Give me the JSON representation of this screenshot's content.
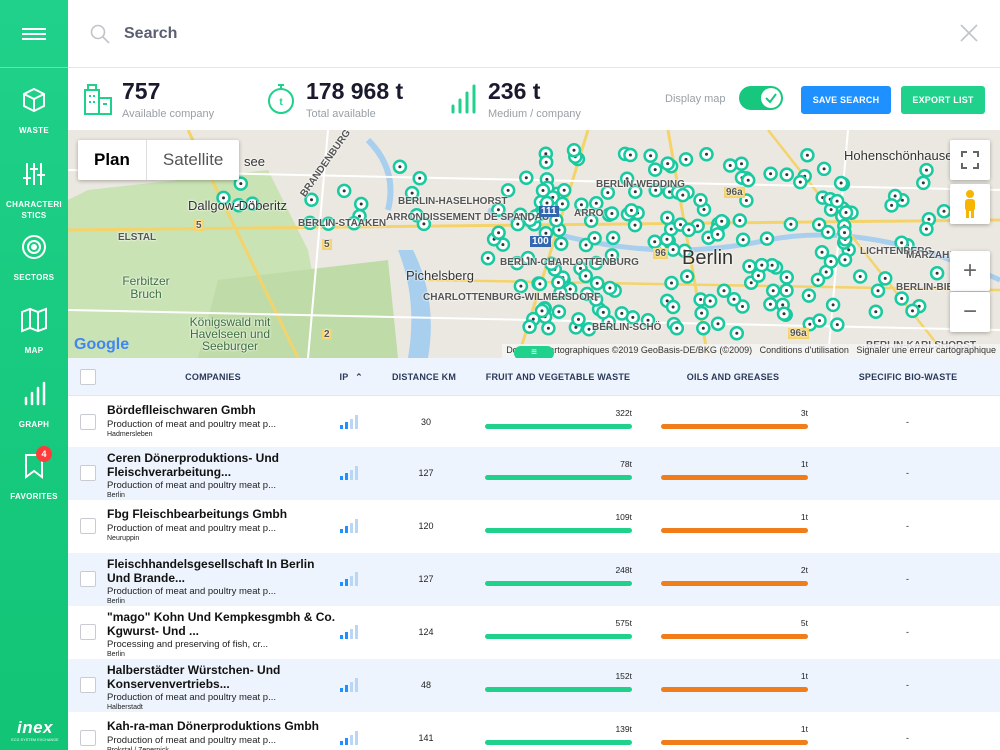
{
  "sidebar": {
    "items": [
      {
        "label": "WASTE",
        "icon": "cube-icon"
      },
      {
        "label": "CHARACTERI STICS",
        "icon": "sliders-icon"
      },
      {
        "label": "SECTORS",
        "icon": "target-icon"
      },
      {
        "label": "MAP",
        "icon": "map-icon"
      },
      {
        "label": "GRAPH",
        "icon": "bar-chart-icon"
      },
      {
        "label": "FAVORITES",
        "icon": "bookmark-icon",
        "badge": "4"
      }
    ],
    "logo": {
      "text": "inex",
      "tagline": "ECO SYSTEM EXCHANGE"
    }
  },
  "search": {
    "placeholder": "Search"
  },
  "stats": [
    {
      "value": "757",
      "label": "Available company",
      "icon": "building-icon"
    },
    {
      "value": "178 968 t",
      "label": "Total available",
      "icon": "stopwatch-icon"
    },
    {
      "value": "236 t",
      "label": "Medium / company",
      "icon": "bars-icon"
    }
  ],
  "display_map": {
    "label": "Display map",
    "on": true
  },
  "buttons": {
    "save_search": "SAVE SEARCH",
    "export_list": "EXPORT LIST"
  },
  "map": {
    "type_plan": "Plan",
    "type_satellite": "Satellite",
    "labels": {
      "brandenburg": "BRANDENBURG",
      "dallgow": "Dallgow-Döberitz",
      "berlin_haselhorst": "BERLIN-HASELHORST",
      "berlin_staaken": "BERLIN-STAAKEN",
      "spandau": "ARRONDISSEMENT DE SPANDAU",
      "elstal": "ELSTAL",
      "pichelsberg": "Pichelsberg",
      "charlottenburg": "BERLIN-CHARLOTTENBURG",
      "charl_wilm": "CHARLOTTENBURG-WILMERSDORF",
      "ferbitzer": "Ferbitzer Bruch",
      "koenigswald": "Königswald mit Havelseen und Seeburger",
      "berlin": "Berlin",
      "berlin_wedding": "BERLIN-WEDDING",
      "berlin_scho": "BERLIN-SCHÖ",
      "hohenschoenhausen": "Hohenschönhausen",
      "lichtenberg": "LICHTENBERG",
      "marzahn": "MARZAHN",
      "berlin_bies": "BERLIN-BIESD",
      "berlin_kar": "BERLIN-KARLSHORST",
      "arro": "ARRO",
      "see": "see",
      "r5a": "5",
      "r5b": "5",
      "r111": "111",
      "r100": "100",
      "r2": "2",
      "r96": "96",
      "r96a": "96a",
      "r96a2": "96a"
    },
    "attribution": "Données cartographiques ©2019 GeoBasis-DE/BKG (©2009)",
    "terms": "Conditions d'utilisation",
    "report": "Signaler une erreur cartographique",
    "google": "Google",
    "fullscreen_icon": "fullscreen-icon",
    "pegman_icon": "pegman-icon",
    "zoom_in": "+",
    "zoom_out": "−"
  },
  "table": {
    "headers": {
      "companies": "COMPANIES",
      "ip": "IP",
      "distance": "DISTANCE KM",
      "fruit": "FRUIT AND VEGETABLE WASTE",
      "oils": "OILS AND GREASES",
      "bio": "SPECIFIC BIO-WASTE"
    },
    "rows": [
      {
        "name": "Bördeflleischwaren Gmbh",
        "desc": "Production of meat and poultry meat p...",
        "city": "Hadmersleben",
        "distance": "30",
        "fruit": "322t",
        "oils": "3t",
        "bio": "-"
      },
      {
        "name": "Ceren Dönerproduktions- Und Fleischverarbeitung...",
        "desc": "Production of meat and poultry meat p...",
        "city": "Berlin",
        "distance": "127",
        "fruit": "78t",
        "oils": "1t",
        "bio": "-"
      },
      {
        "name": "Fbg Fleischbearbeitungs Gmbh",
        "desc": "Production of meat and poultry meat p...",
        "city": "Neuruppin",
        "distance": "120",
        "fruit": "109t",
        "oils": "1t",
        "bio": "-"
      },
      {
        "name": "Fleischhandelsgesellschaft In Berlin Und Brande...",
        "desc": "Production of meat and poultry meat p...",
        "city": "Berlin",
        "distance": "127",
        "fruit": "248t",
        "oils": "2t",
        "bio": "-"
      },
      {
        "name": "\"mago\" Kohn Und Kempkesgmbh & Co. Kgwurst- Und ...",
        "desc": "Processing and preserving of fish, cr...",
        "city": "Berlin",
        "distance": "124",
        "fruit": "575t",
        "oils": "5t",
        "bio": "-"
      },
      {
        "name": "Halberstädter Würstchen- Und Konservenvertriebs...",
        "desc": "Production of meat and poultry meat p...",
        "city": "Halberstadt",
        "distance": "48",
        "fruit": "152t",
        "oils": "1t",
        "bio": "-"
      },
      {
        "name": "Kah-ra-man Dönerproduktions Gmbh",
        "desc": "Production of meat and poultry meat p...",
        "city": "Prokstal / Zepernick",
        "distance": "141",
        "fruit": "139t",
        "oils": "1t",
        "bio": "-"
      }
    ]
  }
}
